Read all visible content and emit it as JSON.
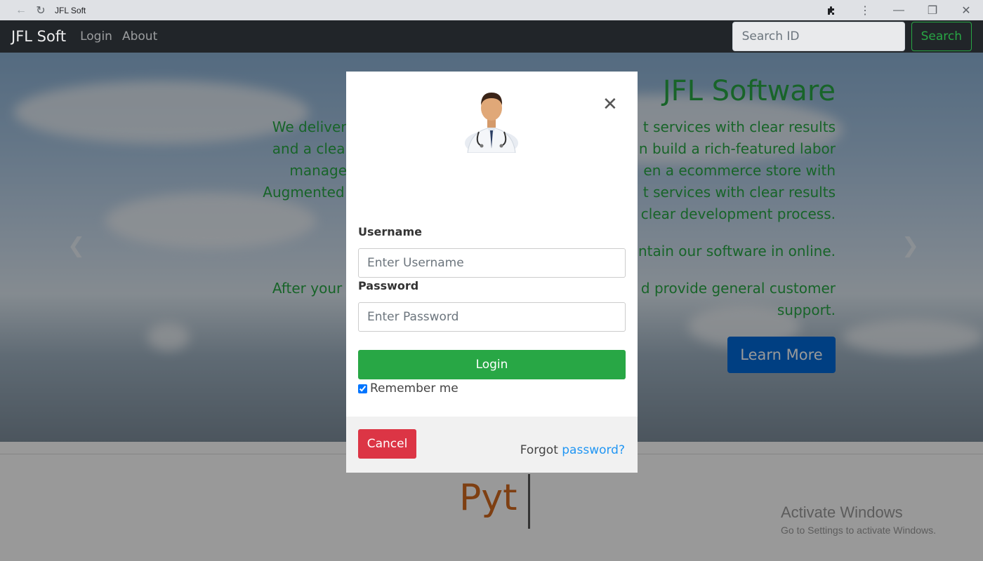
{
  "browser": {
    "tab_title": "JFL Soft",
    "back_icon": "back-arrow-icon",
    "reload_icon": "reload-icon",
    "extensions_icon": "puzzle-icon",
    "menu_icon": "kebab-menu-icon"
  },
  "navbar": {
    "brand": "JFL Soft",
    "links": [
      "Login",
      "About"
    ],
    "search_placeholder": "Search ID",
    "search_button": "Search"
  },
  "hero": {
    "title": "JFL Software",
    "lines": [
      "We deliver comprehens                                              t services with clear results",
      "and a clear developme                                              n build a rich-featured labor",
      "management por                                                    en a ecommerce store with",
      "Augmented Reality. We c                                              t services with clear results",
      "clear development process."
    ],
    "line2": "ntain our software in online.",
    "line3a": "After your web solution                                              d provide general customer",
    "line3b": "support.",
    "learn_more": "Learn More"
  },
  "bottom": {
    "typed_text": "Pyt",
    "activate_title": "Activate Windows",
    "activate_sub": "Go to Settings to activate Windows."
  },
  "modal": {
    "username_label": "Username",
    "username_placeholder": "Enter Username",
    "password_label": "Password",
    "password_placeholder": "Enter Password",
    "login_button": "Login",
    "remember_label": "Remember me",
    "remember_checked": true,
    "cancel_button": "Cancel",
    "forgot_prefix": "Forgot",
    "forgot_link": "password?"
  },
  "colors": {
    "accent_green": "#28a745",
    "primary_blue": "#0069d9",
    "danger_red": "#dc3545",
    "link_blue": "#2196f3"
  }
}
